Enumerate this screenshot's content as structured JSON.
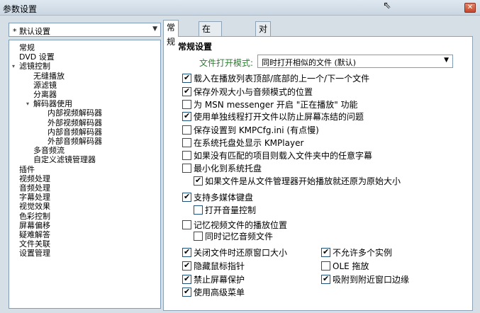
{
  "window": {
    "title": "参数设置",
    "close_icon": "close-icon"
  },
  "preset": {
    "value": "* 默认设置"
  },
  "tree": [
    {
      "label": "常规",
      "indent": 0,
      "expander": ""
    },
    {
      "label": "DVD 设置",
      "indent": 0,
      "expander": ""
    },
    {
      "label": "滤镜控制",
      "indent": 0,
      "expander": "expanded"
    },
    {
      "label": "无缝播放",
      "indent": 1,
      "expander": ""
    },
    {
      "label": "源滤镜",
      "indent": 1,
      "expander": ""
    },
    {
      "label": "分离器",
      "indent": 1,
      "expander": ""
    },
    {
      "label": "解码器使用",
      "indent": 1,
      "expander": "expanded"
    },
    {
      "label": "内部视频解码器",
      "indent": 2,
      "expander": ""
    },
    {
      "label": "外部视频解码器",
      "indent": 2,
      "expander": ""
    },
    {
      "label": "内部音频解码器",
      "indent": 2,
      "expander": ""
    },
    {
      "label": "外部音频解码器",
      "indent": 2,
      "expander": ""
    },
    {
      "label": "多音频流",
      "indent": 1,
      "expander": ""
    },
    {
      "label": "自定义滤镜管理器",
      "indent": 1,
      "expander": ""
    },
    {
      "label": "插件",
      "indent": 0,
      "expander": ""
    },
    {
      "label": "视频处理",
      "indent": 0,
      "expander": ""
    },
    {
      "label": "音频处理",
      "indent": 0,
      "expander": ""
    },
    {
      "label": "字幕处理",
      "indent": 0,
      "expander": ""
    },
    {
      "label": "视觉效果",
      "indent": 0,
      "expander": ""
    },
    {
      "label": "色彩控制",
      "indent": 0,
      "expander": ""
    },
    {
      "label": "屏幕偏移",
      "indent": 0,
      "expander": ""
    },
    {
      "label": "疑难解答",
      "indent": 0,
      "expander": ""
    },
    {
      "label": "文件关联",
      "indent": 0,
      "expander": ""
    },
    {
      "label": "设置管理",
      "indent": 0,
      "expander": ""
    }
  ],
  "tabs": [
    {
      "label": "常规",
      "active": true
    },
    {
      "label": "在启动时...",
      "active": false
    },
    {
      "label": "对话框",
      "active": false
    }
  ],
  "general": {
    "group_title": "常规设置",
    "file_open_mode_label": "文件打开模式:",
    "file_open_mode_value": "同时打开相似的文件 (默认)"
  },
  "options": [
    {
      "label": "载入在播放列表顶部/底部的上一个/下一个文件",
      "checked": true
    },
    {
      "label": "保存外观大小与音频模式的位置",
      "checked": true
    },
    {
      "label": "为 MSN messenger 开启 \"正在播放\" 功能",
      "checked": false
    },
    {
      "label": "使用单独线程打开文件以防止屏幕冻结的问题",
      "checked": true
    },
    {
      "label": "保存设置到 KMPCfg.ini (有点慢)",
      "checked": false
    },
    {
      "label": "在系统托盘处显示 KMPlayer",
      "checked": false
    },
    {
      "label": "如果没有匹配的项目则载入文件夹中的任意字幕",
      "checked": false
    },
    {
      "label": "最小化到系统托盘",
      "checked": false
    },
    {
      "label": "如果文件是从文件管理器开始播放就还原为原始大小",
      "checked": true
    },
    {
      "label": "支持多媒体键盘",
      "checked": true
    },
    {
      "label": "打开音量控制",
      "checked": false
    },
    {
      "label": "记忆视频文件的播放位置",
      "checked": false
    },
    {
      "label": "同时记忆音频文件",
      "checked": false
    },
    {
      "label": "关闭文件时还原窗口大小",
      "checked": true
    },
    {
      "label": "隐藏鼠标指针",
      "checked": true
    },
    {
      "label": "禁止屏幕保护",
      "checked": true
    },
    {
      "label": "使用高级菜单",
      "checked": true
    },
    {
      "label": "不允许多个实例",
      "checked": true
    },
    {
      "label": "OLE 拖放",
      "checked": false
    },
    {
      "label": "吸附到附近窗口边缘",
      "checked": true
    }
  ]
}
